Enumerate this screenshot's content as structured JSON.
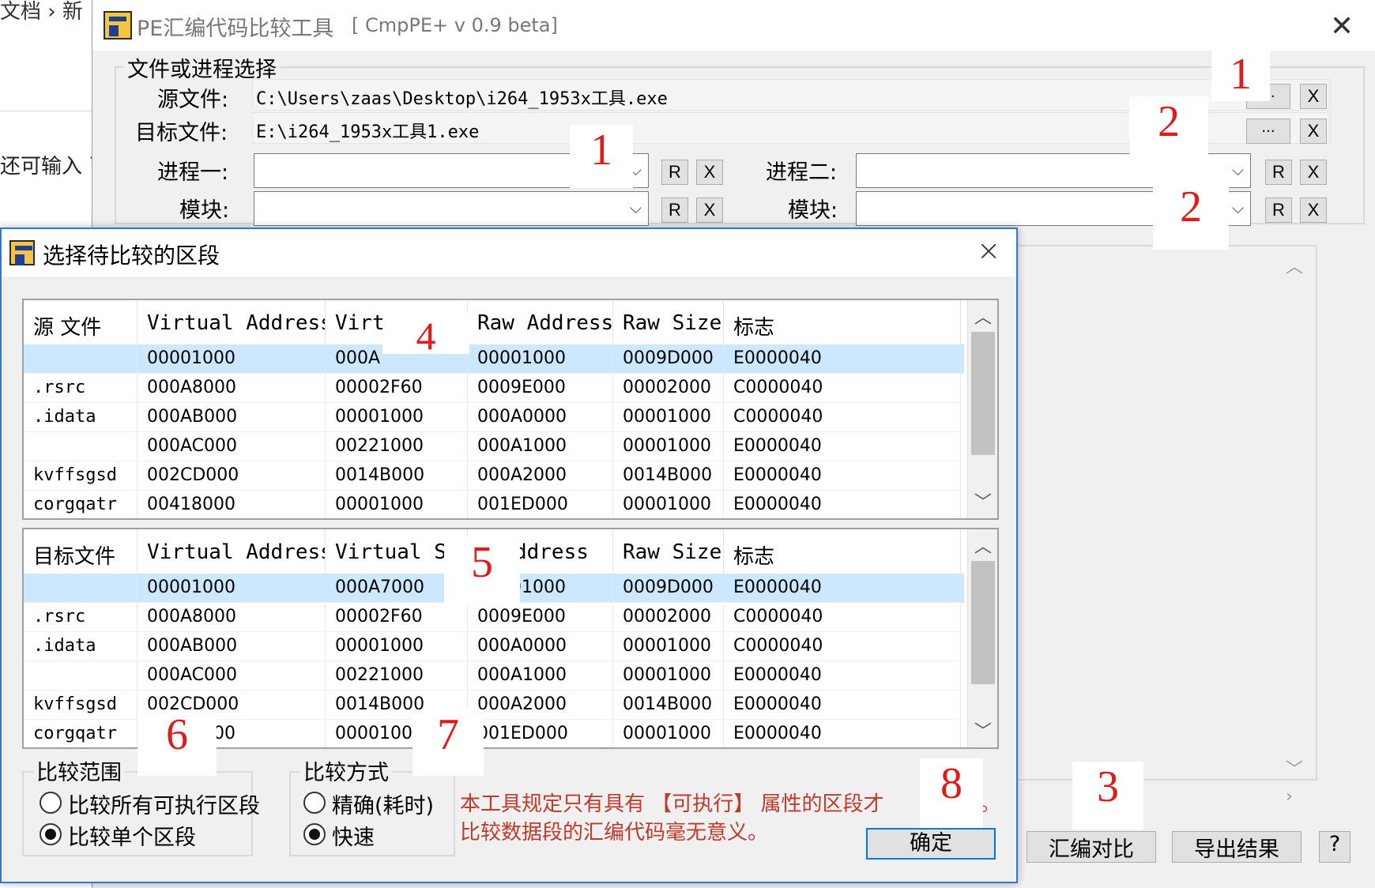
{
  "background": {
    "breadcrumb": "文档 › 新",
    "left_text": "还可输入 已"
  },
  "main_window": {
    "title": "PE汇编代码比较工具",
    "subtitle": "[ CmpPE+ v 0.9 beta]",
    "group_title": "文件或进程选择",
    "source_label": "源文件:",
    "source_value": "C:\\Users\\zaas\\Desktop\\i264_1953x工具.exe",
    "target_label": "目标文件:",
    "target_value": "E:\\i264_1953x工具1.exe",
    "process1_label": "进程一:",
    "process2_label": "进程二:",
    "module_label": "模块:",
    "browse_label": "...",
    "clear_label": "X",
    "refresh_label": "R",
    "compare_button": "汇编对比",
    "export_button": "导出结果",
    "help_button": "?"
  },
  "dialog": {
    "title": "选择待比较的区段",
    "close": "×",
    "columns_source": [
      "源  文件",
      "Virtual Address",
      "Virt",
      "Raw Address",
      "Raw Size",
      "标志"
    ],
    "columns_target": [
      "目标文件",
      "Virtual Address",
      "Virtual Si",
      "· Address",
      "Raw Size",
      "标志"
    ],
    "source_rows": [
      [
        "",
        "00001000",
        "000A",
        "00001000",
        "0009D000",
        "E0000040"
      ],
      [
        ".rsrc",
        "000A8000",
        "00002F60",
        "0009E000",
        "00002000",
        "C0000040"
      ],
      [
        ".idata",
        "000AB000",
        "00001000",
        "000A0000",
        "00001000",
        "C0000040"
      ],
      [
        "",
        "000AC000",
        "00221000",
        "000A1000",
        "00001000",
        "E0000040"
      ],
      [
        "kvffsgsd",
        "002CD000",
        "0014B000",
        "000A2000",
        "0014B000",
        "E0000040"
      ],
      [
        "corgqatr",
        "00418000",
        "00001000",
        "001ED000",
        "00001000",
        "E0000040"
      ]
    ],
    "target_rows": [
      [
        "",
        "00001000",
        "000A7000",
        "00001000",
        "0009D000",
        "E0000040"
      ],
      [
        ".rsrc",
        "000A8000",
        "00002F60",
        "0009E000",
        "00002000",
        "C0000040"
      ],
      [
        ".idata",
        "000AB000",
        "00001000",
        "000A0000",
        "00001000",
        "C0000040"
      ],
      [
        "",
        "000AC000",
        "00221000",
        "000A1000",
        "00001000",
        "E0000040"
      ],
      [
        "kvffsgsd",
        "002CD000",
        "0014B000",
        "000A2000",
        "0014B000",
        "E0000040"
      ],
      [
        "corgqatr",
        "00418000",
        "0000100",
        "001ED000",
        "00001000",
        "E0000040"
      ]
    ],
    "scope_title": "比较范围",
    "scope_options": [
      "比较所有可执行区段",
      "比较单个区段"
    ],
    "mode_title": "比较方式",
    "mode_options": [
      "精确(耗时)",
      "快速"
    ],
    "note_line1": "本工具规定只有具有 【可执行】 属性的区段才",
    "note_line2": "比较数据段的汇编代码毫无意义。",
    "note_suffix": "。",
    "ok_button": "确定"
  },
  "annotations": [
    "1",
    "2",
    "1",
    "2",
    "4",
    "5",
    "6",
    "7",
    "8",
    "3"
  ],
  "colors": {
    "annotation": "#e11b1b",
    "selection": "#cce8ff",
    "dialog_border": "#2b79d8",
    "note_text": "#c0392b"
  }
}
